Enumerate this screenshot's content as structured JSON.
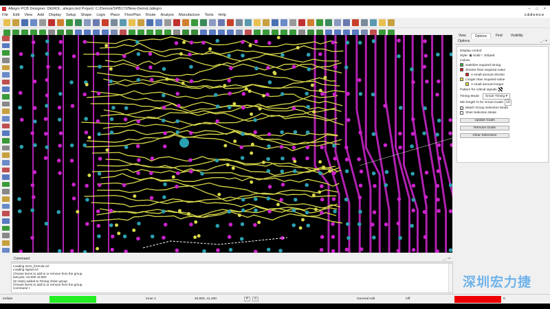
{
  "title": "Allegro PCB Designer: DEMOL: allegro.brd  Project: C:/Demos/SPB172/New-DemoL/allegro",
  "window_controls": [
    "–",
    "□",
    "×"
  ],
  "menu": [
    "File",
    "Edit",
    "View",
    "Add",
    "Display",
    "Setup",
    "Shape",
    "Logic",
    "Place",
    "FloorPlan",
    "Route",
    "Analyze",
    "Manufacture",
    "Tools",
    "Help"
  ],
  "brand": "cādence",
  "panel": {
    "tabs": [
      "View",
      "Options",
      "Find",
      "Visibility"
    ],
    "active_tab": "Options",
    "header": "Options",
    "header_controls": [
      "_",
      "▫",
      "×"
    ],
    "display_control": "Display control",
    "style_label": "Style:",
    "style_options": [
      "Solid",
      "Striped"
    ],
    "style_selected": "Solid",
    "colors_label": "Colors:",
    "colors": [
      {
        "label": "Satisfies required timing",
        "color": "#3cb043",
        "indent": false
      },
      {
        "label": "Shorter than required value",
        "color": "#d42020",
        "indent": false
      },
      {
        "label": "A small amount shorter",
        "color": "#d42020",
        "indent": true
      },
      {
        "label": "Longer than required value",
        "color": "#e6e04a",
        "indent": false
      },
      {
        "label": "A small amount longer",
        "color": "#e6e04a",
        "indent": true
      }
    ],
    "pattern_label": "Pattern for critical signals:",
    "timing_mode_label": "Timing Mode:",
    "timing_mode_value": "Smart Timing",
    "min_length_label": "Min length % for Smart Goals:",
    "min_length_value": "10",
    "match_group_label": "Match Group Selection Mode",
    "match_group_checked": true,
    "xnet_label": "XNet Selection Mode",
    "xnet_checked": false,
    "buttons": [
      "Update Goals",
      "Remove Goals",
      "Clear Selections"
    ]
  },
  "command": {
    "header": "Command",
    "lines": [
      "Loading sono_formula.cvl",
      "Loading signal.cvl",
      "Choose items to add to or remove from the group.",
      "last pick:  22.500 43.900",
      "32 net(s) added to Timing Vision group.",
      "Choose items to add to or remove from the group.",
      "Command >"
    ]
  },
  "status": {
    "mode": "Ireliate",
    "indicator_left_color": "#22ee22",
    "layer": "Inner 1",
    "coords": "20.800, 41.400",
    "p_button": "P",
    "a_button": "A",
    "edit_mode": "General edit",
    "off": "Off",
    "indicator_right_color": "#ee0000",
    "count": "0"
  },
  "watermark": "深圳宏力捷",
  "board_colors": {
    "background": "#000000",
    "trace": "#d8d84a",
    "via_magenta": "#cc22cc",
    "via_cyan": "#2aa0b0",
    "route_magenta": "#b020b0"
  }
}
